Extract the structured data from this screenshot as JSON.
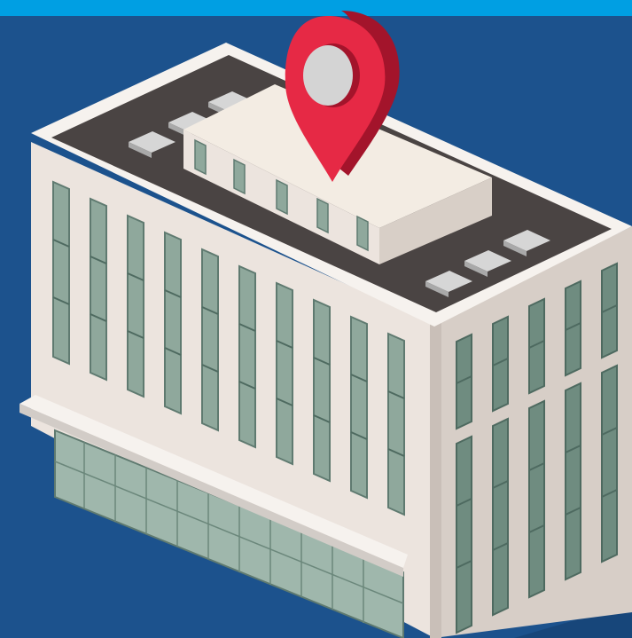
{
  "colors": {
    "top_banner": "#009fe3",
    "background": "#1c528d",
    "wall_light": "#ece4de",
    "wall_side": "#d9cfc8",
    "roof": "#4a4443",
    "parapet": "#f6f2ee",
    "window_glass": "#8fa89c",
    "window_glass_dark": "#5f7a70",
    "pin_red": "#e62945",
    "pin_dark": "#a3142b",
    "pin_center": "#d4d4d4"
  },
  "icons": {
    "location_pin": "map-pin-icon"
  }
}
